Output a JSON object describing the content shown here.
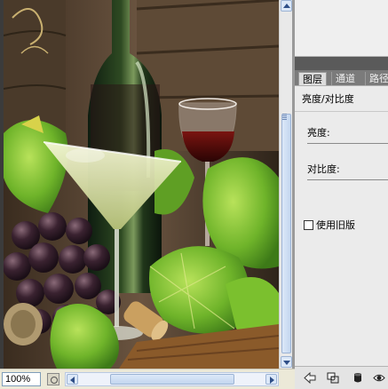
{
  "document": {
    "zoom": "100%"
  },
  "panel": {
    "tabs": [
      {
        "label": "图层"
      },
      {
        "label": "通道"
      },
      {
        "label": "路径"
      }
    ],
    "adjustment": {
      "title": "亮度/对比度",
      "brightness_label": "亮度:",
      "contrast_label": "对比度:",
      "legacy_checkbox_label": "使用旧版",
      "legacy_checked": false
    },
    "bottom_icons": [
      "back-arrow-icon",
      "clip-to-layer-icon",
      "mask-icon",
      "visibility-eye-icon"
    ]
  }
}
